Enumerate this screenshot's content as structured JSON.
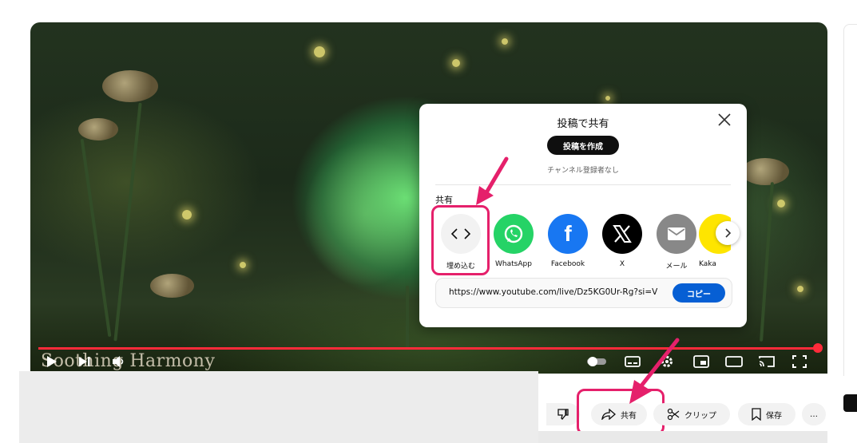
{
  "video": {
    "title_overlay": "Soothing Harmony"
  },
  "share_modal": {
    "title": "投稿で共有",
    "create_post_label": "投稿を作成",
    "subtext": "チャンネル登録者なし",
    "share_heading": "共有",
    "items": [
      {
        "label": "埋め込む",
        "icon": "embed-code-icon",
        "color": "#f2f2f2"
      },
      {
        "label": "WhatsApp",
        "icon": "whatsapp-icon",
        "color": "#25d366"
      },
      {
        "label": "Facebook",
        "icon": "facebook-icon",
        "color": "#1877f2"
      },
      {
        "label": "X",
        "icon": "x-icon",
        "color": "#000000"
      },
      {
        "label": "メール",
        "icon": "mail-icon",
        "color": "#888888"
      },
      {
        "label": "Kaka",
        "icon": "kakao-icon",
        "color": "#fee500"
      }
    ],
    "url": "https://www.youtube.com/live/Dz5KG0Ur-Rg?si=V",
    "copy_label": "コピー"
  },
  "actions": {
    "share_label": "共有",
    "clip_label": "クリップ",
    "save_label": "保存",
    "more_label": "…"
  },
  "colors": {
    "highlight": "#e5206b",
    "progress": "#ff2b3a",
    "copy_button": "#065fd4"
  }
}
